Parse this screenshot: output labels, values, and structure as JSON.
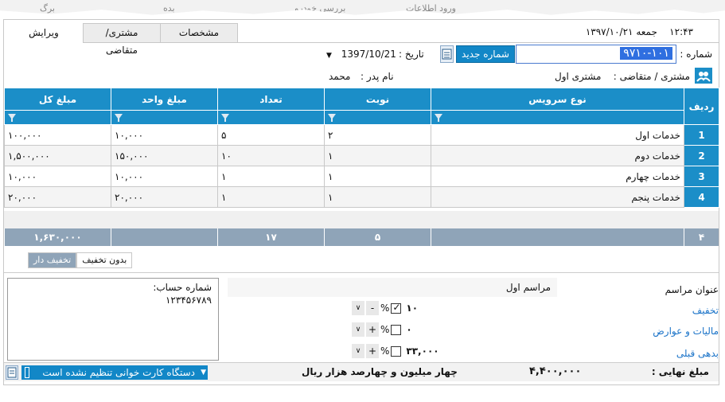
{
  "torn_header": {
    "items": [
      "ورود اطلاعات",
      "بررسی خودرو",
      "بده",
      "برگ"
    ]
  },
  "tabs": [
    {
      "label": "ویرایش",
      "active": true
    },
    {
      "label": "مشتری/متقاضی",
      "active": false
    },
    {
      "label": "مشخصات",
      "active": false
    }
  ],
  "header": {
    "time": "۱۲:۴۳",
    "day": "جمعه",
    "date_fa": "۱۳۹۷/۱۰/۲۱",
    "number_label": "شماره :",
    "number_value": "۹۷۱۰-۱۰۱",
    "new_number_button": "شماره جدید",
    "date_label": "تاریخ :",
    "date_value": "1397/10/21",
    "customer_label": "مشتری / متقاضی :",
    "customer_value": "مشتری اول",
    "father_label": "نام پدر :",
    "father_value": "محمد"
  },
  "grid": {
    "columns": [
      "ردیف",
      "نوع سرویس",
      "نوبت",
      "تعداد",
      "مبلغ واحد",
      "مبلغ کل"
    ],
    "rows": [
      {
        "idx": "1",
        "service": "خدمات اول",
        "turn": "۲",
        "qty": "۵",
        "unit": "۱۰,۰۰۰",
        "total": "۱۰۰,۰۰۰"
      },
      {
        "idx": "2",
        "service": "خدمات دوم",
        "turn": "۱",
        "qty": "۱۰",
        "unit": "۱۵۰,۰۰۰",
        "total": "۱,۵۰۰,۰۰۰"
      },
      {
        "idx": "3",
        "service": "خدمات چهارم",
        "turn": "۱",
        "qty": "۱",
        "unit": "۱۰,۰۰۰",
        "total": "۱۰,۰۰۰"
      },
      {
        "idx": "4",
        "service": "خدمات پنجم",
        "turn": "۱",
        "qty": "۱",
        "unit": "۲۰,۰۰۰",
        "total": "۲۰,۰۰۰"
      }
    ],
    "totals": {
      "idx": "۴",
      "turn": "۵",
      "qty": "۱۷",
      "total": "۱,۶۳۰,۰۰۰"
    }
  },
  "subtabs": [
    "تخفیف دار",
    "بدون تخفیف"
  ],
  "account": {
    "label": "شماره حساب:",
    "value": "۱۲۳۴۵۶۷۸۹"
  },
  "ceremony": {
    "title_label": "عنوان مراسم",
    "title_value": "مراسم اول",
    "discount_label": "تخفیف",
    "discount_value": "۱۰",
    "tax_label": "مالیات و عوارض",
    "tax_value": "۰",
    "debt_label": "بدهی قبلی",
    "debt_value": "۳۳,۰۰۰",
    "percent": "%"
  },
  "footer": {
    "final_label": "مبلغ نهایی :",
    "final_value": "۴,۴۰۰,۰۰۰",
    "words": "چهار میلیون و چهارصد  هزار   ریال",
    "card_reader": "دستگاه کارت خوانی تنظیم نشده است"
  },
  "colors": {
    "grid_header": "#1b8ec8",
    "totals": "#8fa4b8",
    "accent": "#1287c7"
  }
}
